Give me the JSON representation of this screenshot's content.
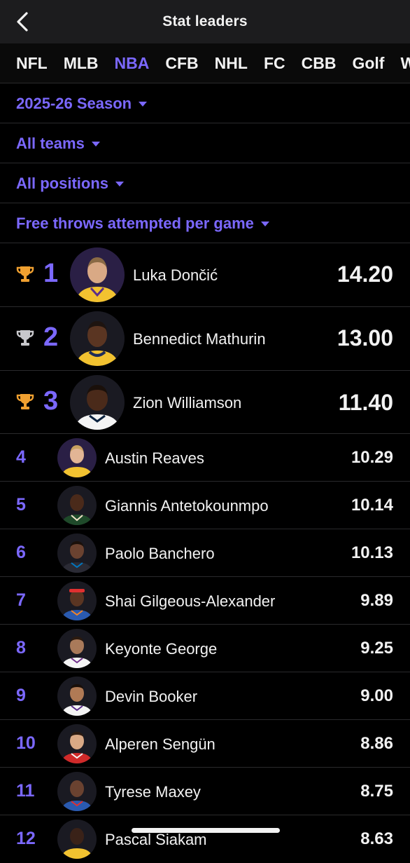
{
  "header": {
    "title": "Stat leaders"
  },
  "tabs": [
    {
      "label": "NFL",
      "active": false
    },
    {
      "label": "MLB",
      "active": false
    },
    {
      "label": "NBA",
      "active": true
    },
    {
      "label": "CFB",
      "active": false
    },
    {
      "label": "NHL",
      "active": false
    },
    {
      "label": "FC",
      "active": false
    },
    {
      "label": "CBB",
      "active": false
    },
    {
      "label": "Golf",
      "active": false
    },
    {
      "label": "WN",
      "active": false
    }
  ],
  "filters": {
    "season": "2025-26 Season",
    "teams": "All teams",
    "positions": "All positions",
    "stat": "Free throws attempted per game"
  },
  "colors": {
    "accent": "#7b68ff",
    "gold": "#f0a030",
    "silver": "#c8c8cc",
    "background": "#000000",
    "header": "#1c1c1e"
  },
  "leaders": [
    {
      "rank": "1",
      "name": "Luka Dončić",
      "value": "14.20",
      "trophy": "gold-trophy-icon"
    },
    {
      "rank": "2",
      "name": "Bennedict Mathurin",
      "value": "13.00",
      "trophy": "silver-trophy-icon"
    },
    {
      "rank": "3",
      "name": "Zion Williamson",
      "value": "11.40",
      "trophy": "bronze-trophy-icon"
    },
    {
      "rank": "4",
      "name": "Austin Reaves",
      "value": "10.29"
    },
    {
      "rank": "5",
      "name": "Giannis Antetokounmpo",
      "value": "10.14"
    },
    {
      "rank": "6",
      "name": "Paolo Banchero",
      "value": "10.13"
    },
    {
      "rank": "7",
      "name": "Shai Gilgeous-Alexander",
      "value": "9.89"
    },
    {
      "rank": "8",
      "name": "Keyonte George",
      "value": "9.25"
    },
    {
      "rank": "9",
      "name": "Devin Booker",
      "value": "9.00"
    },
    {
      "rank": "10",
      "name": "Alperen Sengün",
      "value": "8.86"
    },
    {
      "rank": "11",
      "name": "Tyrese Maxey",
      "value": "8.75"
    },
    {
      "rank": "12",
      "name": "Pascal Siakam",
      "value": "8.63"
    }
  ]
}
